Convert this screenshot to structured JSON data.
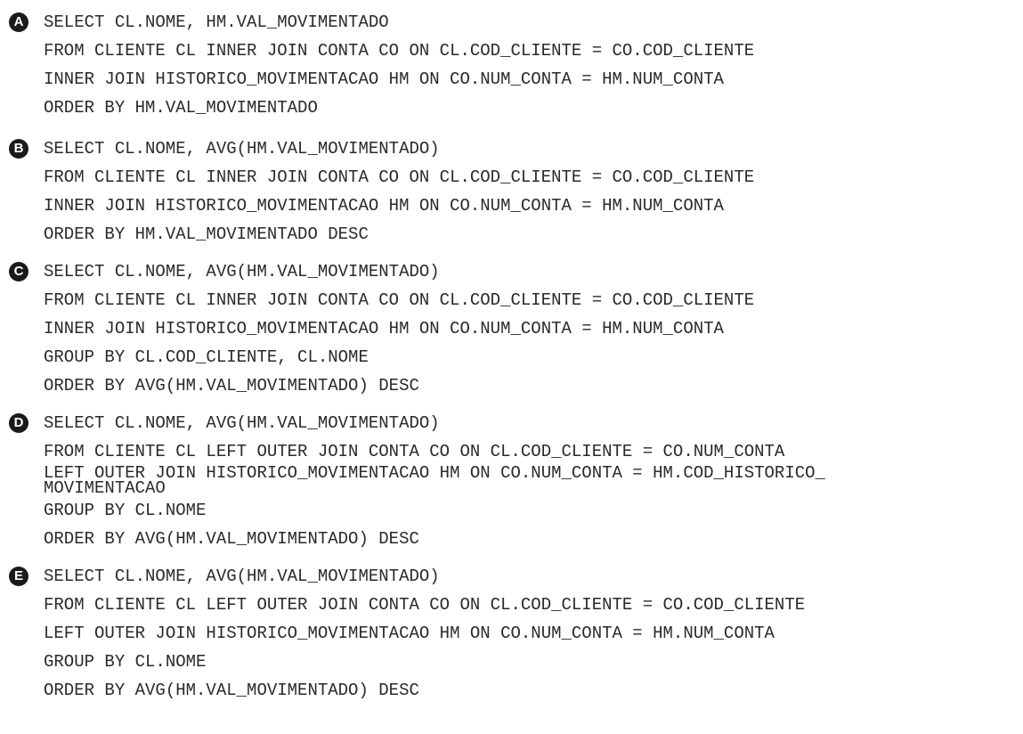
{
  "options": [
    {
      "letter": "A",
      "lines": [
        "SELECT CL.NOME, HM.VAL_MOVIMENTADO",
        "FROM CLIENTE CL INNER JOIN CONTA CO ON CL.COD_CLIENTE = CO.COD_CLIENTE",
        "INNER JOIN HISTORICO_MOVIMENTACAO HM ON CO.NUM_CONTA = HM.NUM_CONTA",
        "ORDER BY HM.VAL_MOVIMENTADO"
      ]
    },
    {
      "letter": "B",
      "lines": [
        "SELECT CL.NOME, AVG(HM.VAL_MOVIMENTADO)",
        "FROM CLIENTE CL INNER JOIN CONTA CO ON CL.COD_CLIENTE = CO.COD_CLIENTE",
        "INNER JOIN HISTORICO_MOVIMENTACAO HM ON CO.NUM_CONTA = HM.NUM_CONTA",
        "ORDER BY HM.VAL_MOVIMENTADO DESC"
      ]
    },
    {
      "letter": "C",
      "lines": [
        "SELECT CL.NOME, AVG(HM.VAL_MOVIMENTADO)",
        "FROM CLIENTE CL INNER JOIN CONTA CO ON CL.COD_CLIENTE = CO.COD_CLIENTE",
        "INNER JOIN HISTORICO_MOVIMENTACAO HM ON CO.NUM_CONTA = HM.NUM_CONTA",
        "GROUP BY CL.COD_CLIENTE, CL.NOME",
        "ORDER BY AVG(HM.VAL_MOVIMENTADO) DESC"
      ]
    },
    {
      "letter": "D",
      "lines": [
        "SELECT CL.NOME, AVG(HM.VAL_MOVIMENTADO)",
        "FROM CLIENTE CL LEFT OUTER JOIN CONTA CO ON CL.COD_CLIENTE = CO.NUM_CONTA",
        "LEFT OUTER JOIN HISTORICO_MOVIMENTACAO HM ON CO.NUM_CONTA = HM.COD_HISTORICO_\nMOVIMENTACAO",
        "GROUP BY CL.NOME",
        "ORDER BY AVG(HM.VAL_MOVIMENTADO) DESC"
      ]
    },
    {
      "letter": "E",
      "lines": [
        "SELECT CL.NOME, AVG(HM.VAL_MOVIMENTADO)",
        "FROM CLIENTE CL LEFT OUTER JOIN CONTA CO ON CL.COD_CLIENTE = CO.COD_CLIENTE",
        "LEFT OUTER JOIN HISTORICO_MOVIMENTACAO HM ON CO.NUM_CONTA = HM.NUM_CONTA",
        "GROUP BY CL.NOME",
        "ORDER BY AVG(HM.VAL_MOVIMENTADO) DESC"
      ]
    }
  ]
}
